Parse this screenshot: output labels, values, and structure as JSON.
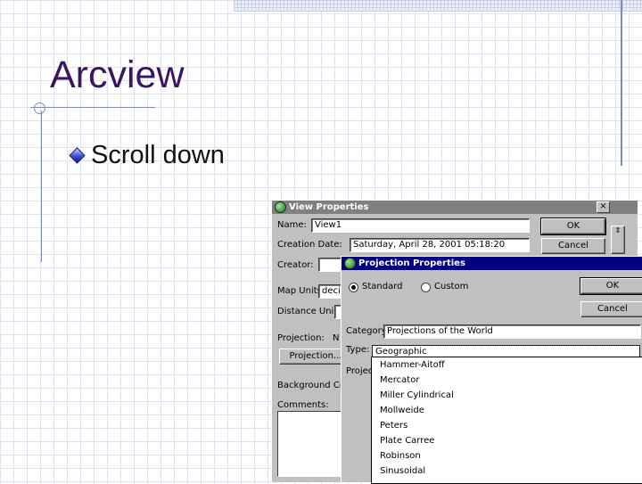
{
  "slide": {
    "title": "Arcview",
    "bullets": [
      {
        "text": "Scroll down"
      }
    ]
  },
  "view_properties": {
    "title": "View Properties",
    "close_glyph": "×",
    "name_label": "Name:",
    "name_value": "View1",
    "creation_date_label": "Creation Date:",
    "creation_date_value": "Saturday, April 28, 2001 05:18:20",
    "creator_label": "Creator:",
    "map_units_label": "Map Units:",
    "map_units_value": "deci",
    "distance_units_label": "Distance Units:",
    "projection_label": "Projection:",
    "projection_value_partial": "N",
    "projection_button": "Projection...",
    "background_color_label": "Background Coo",
    "comments_label": "Comments:",
    "ok_button": "OK",
    "cancel_button": "Cancel"
  },
  "projection_properties": {
    "title": "Projection Properties",
    "standard_label": "Standard",
    "custom_label": "Custom",
    "selected_mode": "standard",
    "ok_button": "OK",
    "cancel_button": "Cancel",
    "category_label": "Category:",
    "category_value": "Projections of the World",
    "type_label": "Type:",
    "type_value": "Geographic",
    "projection_label_partial": "Projec",
    "type_options": [
      "Hammer-Aitoff",
      "Mercator",
      "Miller Cylindrical",
      "Mollweide",
      "Peters",
      "Plate Carree",
      "Robinson",
      "Sinusoidal"
    ]
  }
}
